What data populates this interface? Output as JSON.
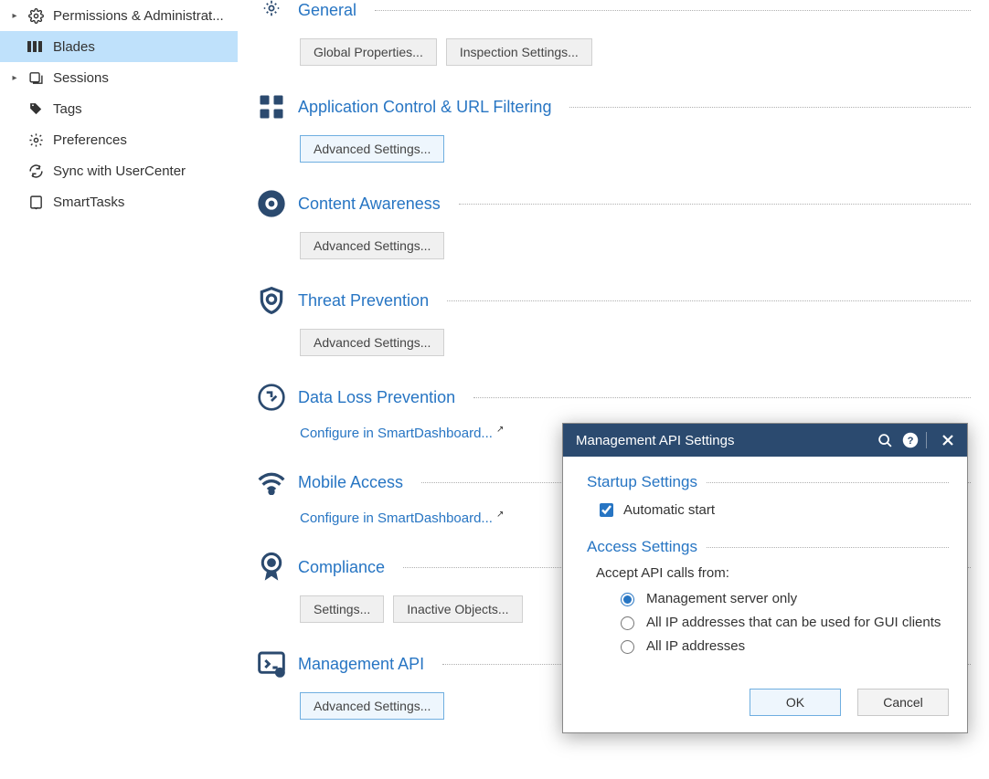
{
  "sidebar": {
    "items": [
      {
        "label": "Permissions & Administrat...",
        "icon": "gear",
        "expandable": true
      },
      {
        "label": "Blades",
        "icon": "blades",
        "selected": true
      },
      {
        "label": "Sessions",
        "icon": "sessions",
        "expandable": true
      },
      {
        "label": "Tags",
        "icon": "tag"
      },
      {
        "label": "Preferences",
        "icon": "gear2"
      },
      {
        "label": "Sync with UserCenter",
        "icon": "sync"
      },
      {
        "label": "SmartTasks",
        "icon": "smarttasks"
      }
    ]
  },
  "sections": {
    "general": {
      "title": "General",
      "buttons": {
        "globalProps": "Global Properties...",
        "inspection": "Inspection Settings..."
      }
    },
    "appControl": {
      "title": "Application Control & URL Filtering",
      "buttons": {
        "advanced": "Advanced Settings..."
      }
    },
    "contentAwareness": {
      "title": "Content Awareness",
      "buttons": {
        "advanced": "Advanced Settings..."
      }
    },
    "threatPrevention": {
      "title": "Threat Prevention",
      "buttons": {
        "advanced": "Advanced Settings..."
      }
    },
    "dlp": {
      "title": "Data Loss Prevention",
      "link": "Configure in SmartDashboard..."
    },
    "mobileAccess": {
      "title": "Mobile Access",
      "link": "Configure in SmartDashboard..."
    },
    "compliance": {
      "title": "Compliance",
      "buttons": {
        "settings": "Settings...",
        "inactive": "Inactive Objects..."
      }
    },
    "mgmtApi": {
      "title": "Management API",
      "buttons": {
        "advanced": "Advanced Settings..."
      }
    }
  },
  "dialog": {
    "title": "Management API Settings",
    "startup": {
      "title": "Startup Settings",
      "autoStart": "Automatic start",
      "autoStartChecked": true
    },
    "access": {
      "title": "Access Settings",
      "label": "Accept API calls from:",
      "options": {
        "mgmtOnly": "Management server only",
        "guiClients": "All IP addresses that can be used for GUI clients",
        "allIps": "All IP addresses"
      },
      "selected": "mgmtOnly"
    },
    "buttons": {
      "ok": "OK",
      "cancel": "Cancel"
    }
  }
}
